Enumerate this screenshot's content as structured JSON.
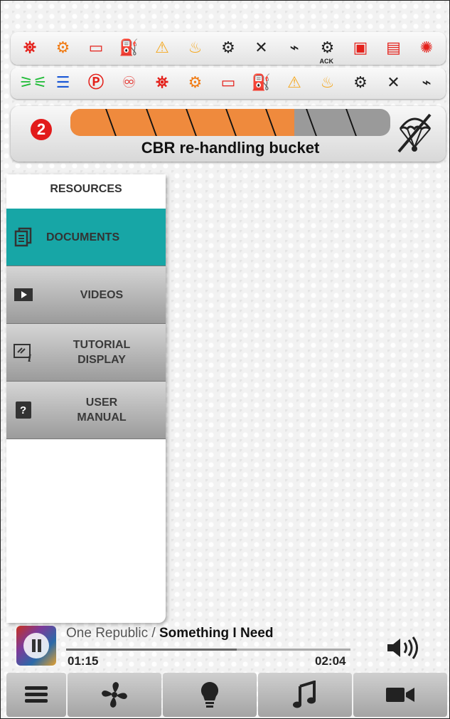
{
  "warning_rows": [
    [
      {
        "name": "engine-stop-icon",
        "glyph": "⛯",
        "color": "#e4201a"
      },
      {
        "name": "engine-check-icon",
        "glyph": "⚙",
        "color": "#f07a12"
      },
      {
        "name": "battery-icon",
        "glyph": "▭",
        "color": "#e4201a"
      },
      {
        "name": "oil-pressure-icon",
        "glyph": "⛽",
        "color": "#f07a12"
      },
      {
        "name": "hydraulic-filter-icon",
        "glyph": "⚠",
        "color": "#f5a81f"
      },
      {
        "name": "coolant-temp-icon",
        "glyph": "♨",
        "color": "#f5a81f"
      },
      {
        "name": "transmission-icon",
        "glyph": "⚙",
        "color": "#222"
      },
      {
        "name": "transmission-disabled-icon",
        "glyph": "✕",
        "color": "#222"
      },
      {
        "name": "transmission-temp-icon",
        "glyph": "⌁",
        "color": "#222"
      },
      {
        "name": "transmission-ack-icon",
        "glyph": "⚙",
        "color": "#222"
      },
      {
        "name": "fuel-level-icon",
        "glyph": "▣",
        "color": "#e4201a"
      },
      {
        "name": "fuel-temp-icon",
        "glyph": "▤",
        "color": "#e4201a"
      },
      {
        "name": "water-in-fuel-icon",
        "glyph": "✺",
        "color": "#e4201a"
      }
    ],
    [
      {
        "name": "side-lights-icon",
        "glyph": "⚞⚟",
        "color": "#1dbb35"
      },
      {
        "name": "high-beam-icon",
        "glyph": "☰",
        "color": "#1957d6"
      },
      {
        "name": "parking-brake-icon",
        "glyph": "Ⓟ",
        "color": "#e4201a"
      },
      {
        "name": "seatbelt-icon",
        "glyph": "♾",
        "color": "#e4201a"
      },
      {
        "name": "engine-stop-icon",
        "glyph": "⛯",
        "color": "#e4201a"
      },
      {
        "name": "engine-check-icon",
        "glyph": "⚙",
        "color": "#f07a12"
      },
      {
        "name": "battery-icon",
        "glyph": "▭",
        "color": "#e4201a"
      },
      {
        "name": "oil-pressure-icon",
        "glyph": "⛽",
        "color": "#f07a12"
      },
      {
        "name": "hydraulic-filter-icon",
        "glyph": "⚠",
        "color": "#f5a81f"
      },
      {
        "name": "coolant-temp-icon",
        "glyph": "♨",
        "color": "#f5a81f"
      },
      {
        "name": "transmission-icon",
        "glyph": "⚙",
        "color": "#222"
      },
      {
        "name": "transmission-disabled-icon",
        "glyph": "✕",
        "color": "#222"
      },
      {
        "name": "transmission-temp-icon",
        "glyph": "⌁",
        "color": "#222"
      }
    ]
  ],
  "ack_label": "ACK",
  "status": {
    "badge": "2",
    "title": "CBR re-handling bucket",
    "progress": 0.7,
    "segments": 8
  },
  "resources": {
    "title": "RESOURCES",
    "items": [
      {
        "label": "DOCUMENTS",
        "icon": "document-icon",
        "active": true
      },
      {
        "label": "VIDEOS",
        "icon": "video-icon",
        "active": false
      },
      {
        "label": "TUTORIAL\nDISPLAY",
        "icon": "tutorial-icon",
        "active": false
      },
      {
        "label": "USER\nMANUAL",
        "icon": "manual-icon",
        "active": false
      }
    ]
  },
  "player": {
    "artist": "One Republic",
    "separator": " / ",
    "song": "Something I Need",
    "elapsed": "01:15",
    "duration": "02:04",
    "progress": 0.6
  },
  "nav": [
    {
      "icon": "menu-icon"
    },
    {
      "icon": "fan-icon"
    },
    {
      "icon": "lightbulb-icon"
    },
    {
      "icon": "music-icon"
    },
    {
      "icon": "video-camera-icon"
    }
  ]
}
